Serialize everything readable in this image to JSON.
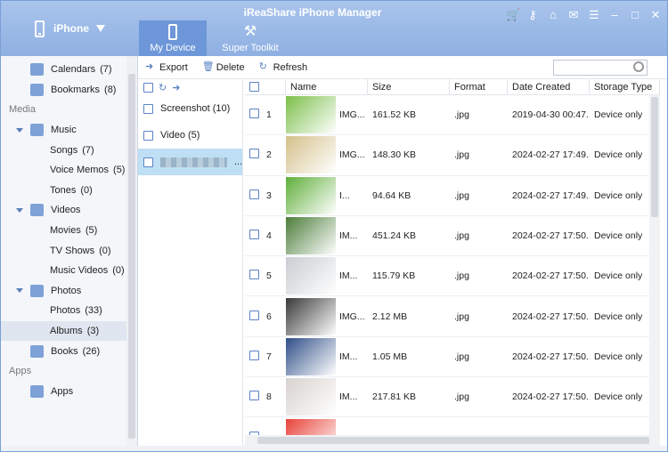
{
  "app": {
    "title": "iReaShare iPhone Manager"
  },
  "device": {
    "name": "iPhone"
  },
  "nav": {
    "tabs": [
      {
        "label": "My Device"
      },
      {
        "label": "Super Toolkit"
      }
    ]
  },
  "sidebar": {
    "items": [
      {
        "label": "Calendars",
        "count": "(7)",
        "level": 1,
        "icon": "calendar-icon"
      },
      {
        "label": "Bookmarks",
        "count": "(8)",
        "level": 1,
        "icon": "bookmark-icon"
      },
      {
        "label": "Media",
        "level": 0
      },
      {
        "label": "Music",
        "level": 1,
        "icon": "music-icon"
      },
      {
        "label": "Songs",
        "count": "(7)",
        "level": 2
      },
      {
        "label": "Voice Memos",
        "count": "(5)",
        "level": 2
      },
      {
        "label": "Tones",
        "count": "(0)",
        "level": 2
      },
      {
        "label": "Videos",
        "level": 1,
        "icon": "video-icon"
      },
      {
        "label": "Movies",
        "count": "(5)",
        "level": 2
      },
      {
        "label": "TV Shows",
        "count": "(0)",
        "level": 2
      },
      {
        "label": "Music Videos",
        "count": "(0)",
        "level": 2
      },
      {
        "label": "Photos",
        "level": 1,
        "icon": "photos-icon"
      },
      {
        "label": "Photos",
        "count": "(33)",
        "level": 2
      },
      {
        "label": "Albums",
        "count": "(3)",
        "level": 2
      },
      {
        "label": "Books",
        "count": "(26)",
        "level": 1,
        "icon": "books-icon"
      },
      {
        "label": "Apps",
        "level": 0
      },
      {
        "label": "Apps",
        "level": 1,
        "icon": "apps-icon"
      }
    ]
  },
  "toolbar": {
    "export": "Export",
    "delete": "Delete",
    "refresh": "Refresh"
  },
  "search": {
    "placeholder": ""
  },
  "albums": [
    {
      "label": "Screenshot (10)"
    },
    {
      "label": "Video (5)"
    },
    {
      "label": "..."
    }
  ],
  "table": {
    "columns": [
      "Name",
      "Size",
      "Format",
      "Date Created",
      "Storage Type"
    ],
    "rows": [
      {
        "num": "1",
        "name": "IMG...",
        "size": "161.52 KB",
        "format": ".jpg",
        "date": "2019-04-30 00:47...",
        "storage": "Device only",
        "color": "#7bbf4a"
      },
      {
        "num": "2",
        "name": "IMG...",
        "size": "148.30 KB",
        "format": ".jpg",
        "date": "2024-02-27 17:49...",
        "storage": "Device only",
        "color": "#d4c08a"
      },
      {
        "num": "3",
        "name": "I...",
        "size": "94.64 KB",
        "format": ".jpg",
        "date": "2024-02-27 17:49...",
        "storage": "Device only",
        "color": "#5fae3a"
      },
      {
        "num": "4",
        "name": "IM...",
        "size": "451.24 KB",
        "format": ".jpg",
        "date": "2024-02-27 17:50...",
        "storage": "Device only",
        "color": "#4c7d3a"
      },
      {
        "num": "5",
        "name": "IM...",
        "size": "115.79 KB",
        "format": ".jpg",
        "date": "2024-02-27 17:50...",
        "storage": "Device only",
        "color": "#c9ccd1"
      },
      {
        "num": "6",
        "name": "IMG...",
        "size": "2.12 MB",
        "format": ".jpg",
        "date": "2024-02-27 17:50...",
        "storage": "Device only",
        "color": "#3a3a3a"
      },
      {
        "num": "7",
        "name": "IM...",
        "size": "1.05 MB",
        "format": ".jpg",
        "date": "2024-02-27 17:50...",
        "storage": "Device only",
        "color": "#2f4f88"
      },
      {
        "num": "8",
        "name": "IM...",
        "size": "217.81 KB",
        "format": ".jpg",
        "date": "2024-02-27 17:50...",
        "storage": "Device only",
        "color": "#d8d2cf"
      },
      {
        "num": "",
        "name": "",
        "size": "",
        "format": "",
        "date": "",
        "storage": "",
        "color": "#e8433a"
      }
    ]
  },
  "colors": {
    "accent": "#8fb0e2",
    "selected": "#bfdff5"
  }
}
